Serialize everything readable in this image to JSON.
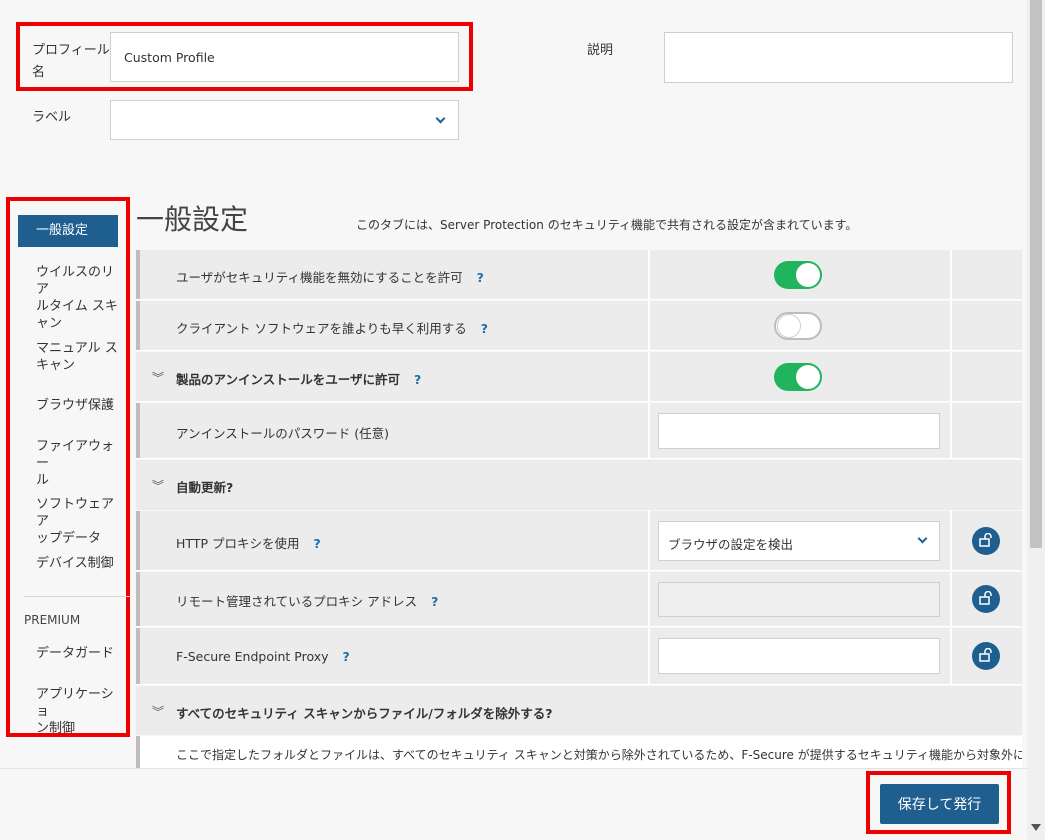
{
  "header": {
    "profile_name_label_1": "プロフィール",
    "profile_name_label_2": "名",
    "profile_name_value": "Custom Profile",
    "description_label": "説明",
    "description_value": "",
    "label_label": "ラベル",
    "label_value": ""
  },
  "sidebar": {
    "items": [
      {
        "label": "一般設定",
        "active": true
      },
      {
        "label_1": "ウイルスのリア",
        "label_2": "ルタイム スキ",
        "label_3": "ャン"
      },
      {
        "label_1": "マニュアル ス",
        "label_2": "キャン"
      },
      {
        "label": "ブラウザ保護"
      },
      {
        "label_1": "ファイアウォー",
        "label_2": "ル"
      },
      {
        "label_1": "ソフトウェア ア",
        "label_2": "ップデータ"
      },
      {
        "label": "デバイス制御"
      }
    ],
    "premium_heading": "PREMIUM",
    "premium_items": [
      {
        "label": "データガード"
      },
      {
        "label_1": "アプリケーショ",
        "label_2": "ン制御"
      }
    ]
  },
  "main": {
    "title": "一般設定",
    "subtitle": "このタブには、Server Protection のセキュリティ機能で共有される設定が含まれています。",
    "help_glyph": "?",
    "rows": [
      {
        "label": "ユーザがセキュリティ機能を無効にすることを許可",
        "toggle": "on"
      },
      {
        "label": "クライアント ソフトウェアを誰よりも早く利用する",
        "toggle": "off"
      },
      {
        "label": "製品のアンインストールをユーザに許可",
        "toggle": "on",
        "section": true
      },
      {
        "label": "アンインストールのパスワード (任意)",
        "input": ""
      },
      {
        "label": "自動更新",
        "section": true
      },
      {
        "label": "HTTP プロキシを使用",
        "select": "ブラウザの設定を検出"
      },
      {
        "label": "リモート管理されているプロキシ アドレス",
        "input": ""
      },
      {
        "label": "F-Secure Endpoint Proxy",
        "input": ""
      },
      {
        "label": "すべてのセキュリティ スキャンからファイル/フォルダを除外する",
        "section": true
      }
    ],
    "exclusion_note": "ここで指定したフォルダとファイルは、すべてのセキュリティ スキャンと対策から除外されているため、F-Secure が提供するセキュリティ機能から対象外になり"
  },
  "footer": {
    "save_publish_label": "保存して発行"
  },
  "colors": {
    "accent": "#1f5f8f",
    "toggle_on": "#20b45c",
    "highlight": "#ee0000"
  }
}
